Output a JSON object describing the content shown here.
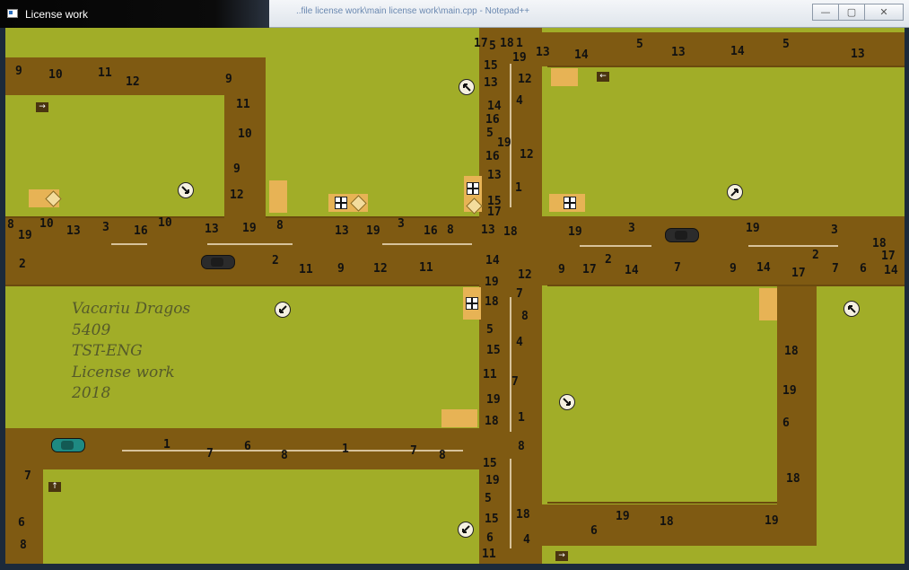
{
  "window": {
    "title": "License work",
    "background_text": "..file license work\\main license work\\main.cpp - Notepad++",
    "minimize_glyph": "—",
    "maximize_glyph": "▢",
    "close_glyph": "✕"
  },
  "info": {
    "lines": [
      "Vacariu Dragos",
      "5409",
      "TST-ENG",
      "License work",
      "2018"
    ]
  },
  "colors": {
    "grass": "#a1ad28",
    "road": "#7f5a12",
    "car_black": "#2b2b2b",
    "car_teal": "#1e8a82"
  },
  "icons": {
    "roundabout_sign": "no-turn-sign-icon",
    "arrow_marker": "direction-arrow-icon",
    "priority": "priority-diamond-icon",
    "crossing": "crossing-sign-icon",
    "yield": "yield-triangle-icon"
  },
  "numbers": [
    "17",
    "5",
    "18",
    "1",
    "19",
    "13",
    "14",
    "5",
    "13",
    "14",
    "5",
    "13",
    "9",
    "10",
    "11",
    "12",
    "9",
    "11",
    "10",
    "9",
    "12",
    "15",
    "13",
    "12",
    "14",
    "4",
    "16",
    "5",
    "19",
    "16",
    "12",
    "13",
    "1",
    "15",
    "17",
    "8",
    "19",
    "10",
    "13",
    "3",
    "16",
    "10",
    "13",
    "19",
    "8",
    "13",
    "19",
    "3",
    "16",
    "8",
    "13",
    "18",
    "19",
    "3",
    "19",
    "3",
    "18",
    "17",
    "14",
    "2",
    "2",
    "11",
    "9",
    "12",
    "11",
    "14",
    "12",
    "9",
    "17",
    "2",
    "14",
    "7",
    "9",
    "14",
    "17",
    "2",
    "7",
    "6",
    "19",
    "18",
    "7",
    "8",
    "5",
    "4",
    "15",
    "11",
    "7",
    "19",
    "18",
    "1",
    "15",
    "19",
    "5",
    "15",
    "6",
    "11",
    "18",
    "4",
    "8",
    "18",
    "19",
    "6",
    "18",
    "19",
    "6",
    "18",
    "19",
    "1",
    "7",
    "6",
    "8",
    "1",
    "7",
    "8",
    "7",
    "6",
    "8"
  ]
}
